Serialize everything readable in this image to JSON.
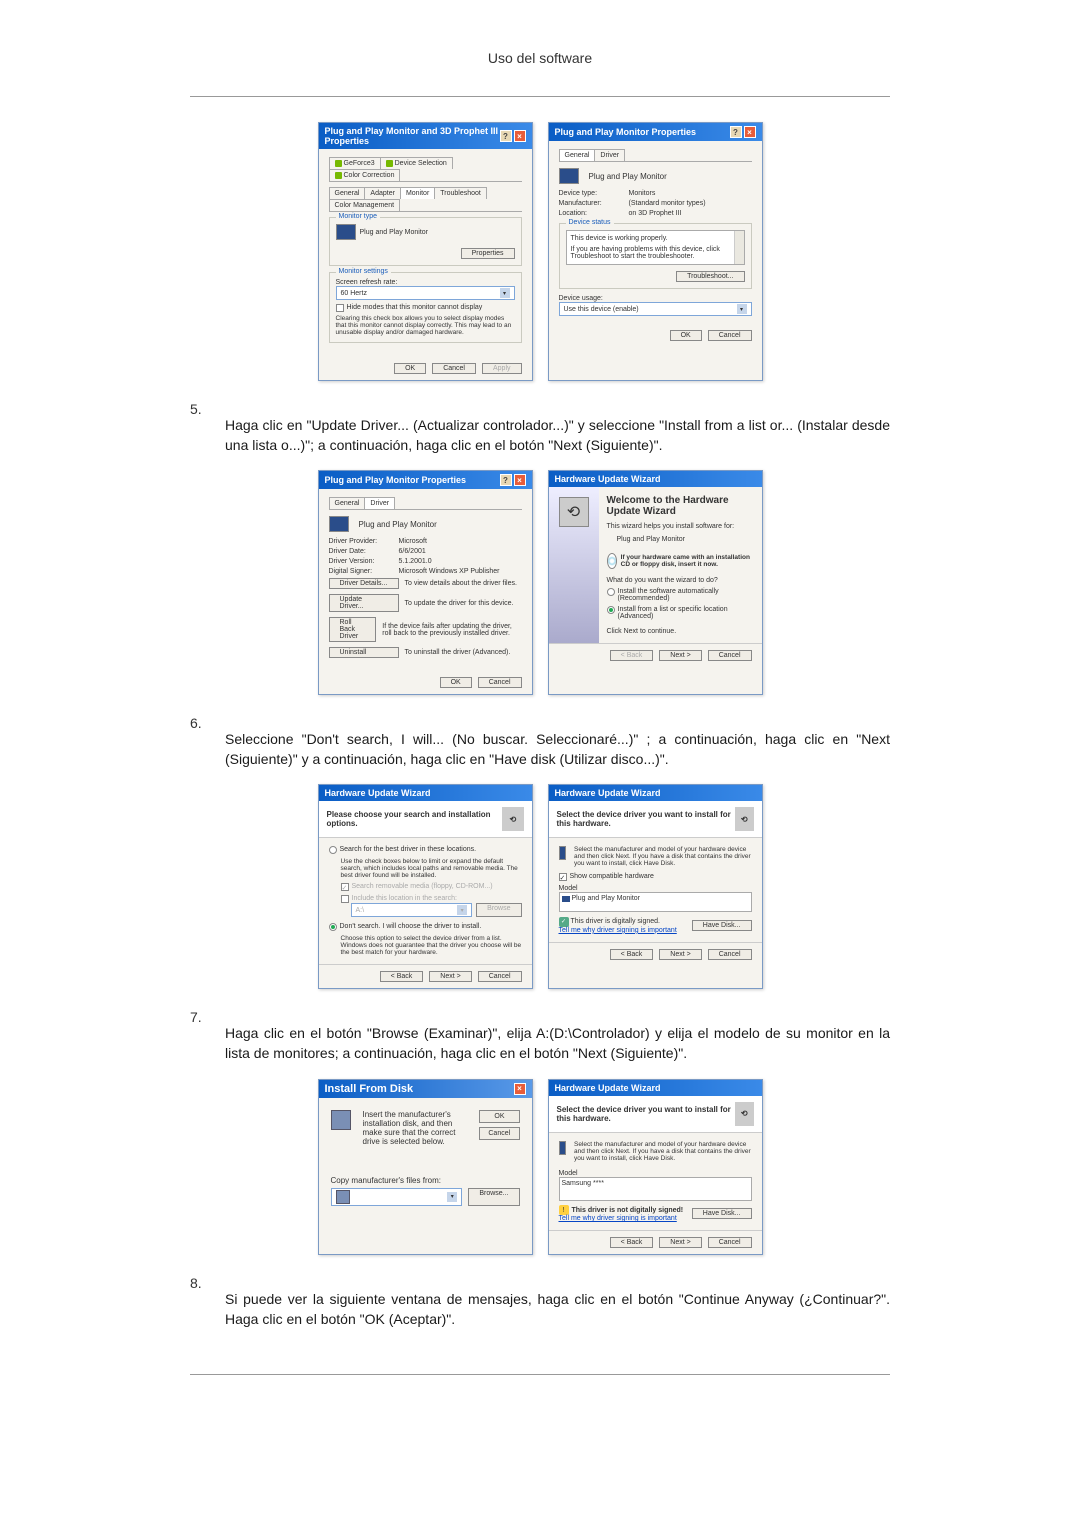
{
  "page_header": "Uso del software",
  "dialog1": {
    "title": "Plug and Play Monitor and 3D Prophet III Properties",
    "tabs_row1": [
      "GeForce3",
      "Device Selection",
      "Color Correction"
    ],
    "tabs_row2": [
      "General",
      "Adapter",
      "Monitor",
      "Troubleshoot",
      "Color Management"
    ],
    "monitor_type_title": "Monitor type",
    "monitor_name": "Plug and Play Monitor",
    "properties_btn": "Properties",
    "monitor_settings_title": "Monitor settings",
    "refresh_label": "Screen refresh rate:",
    "refresh_value": "60 Hertz",
    "hide_modes_label": "Hide modes that this monitor cannot display",
    "hide_modes_desc": "Clearing this check box allows you to select display modes that this monitor cannot display correctly. This may lead to an unusable display and/or damaged hardware.",
    "ok_btn": "OK",
    "cancel_btn": "Cancel",
    "apply_btn": "Apply"
  },
  "dialog2": {
    "title": "Plug and Play Monitor Properties",
    "tab_general": "General",
    "tab_driver": "Driver",
    "device_name": "Plug and Play Monitor",
    "device_type_label": "Device type:",
    "device_type_value": "Monitors",
    "manufacturer_label": "Manufacturer:",
    "manufacturer_value": "(Standard monitor types)",
    "location_label": "Location:",
    "location_value": "on 3D Prophet III",
    "device_status_title": "Device status",
    "status_text1": "This device is working properly.",
    "status_text2": "If you are having problems with this device, click Troubleshoot to start the troubleshooter.",
    "troubleshoot_btn": "Troubleshoot...",
    "usage_label": "Device usage:",
    "usage_value": "Use this device (enable)",
    "ok_btn": "OK",
    "cancel_btn": "Cancel"
  },
  "step5": {
    "num": "5.",
    "text": "Haga clic en \"Update Driver... (Actualizar controlador...)\" y seleccione \"Install from a list or... (Instalar desde una lista o...)\"; a continuación, haga clic en el botón \"Next (Siguiente)\"."
  },
  "dialog3": {
    "title": "Plug and Play Monitor Properties",
    "tab_general": "General",
    "tab_driver": "Driver",
    "device_name": "Plug and Play Monitor",
    "provider_label": "Driver Provider:",
    "provider_value": "Microsoft",
    "date_label": "Driver Date:",
    "date_value": "6/6/2001",
    "version_label": "Driver Version:",
    "version_value": "5.1.2001.0",
    "signer_label": "Digital Signer:",
    "signer_value": "Microsoft Windows XP Publisher",
    "details_btn": "Driver Details...",
    "details_desc": "To view details about the driver files.",
    "update_btn": "Update Driver...",
    "update_desc": "To update the driver for this device.",
    "rollback_btn": "Roll Back Driver",
    "rollback_desc": "If the device fails after updating the driver, roll back to the previously installed driver.",
    "uninstall_btn": "Uninstall",
    "uninstall_desc": "To uninstall the driver (Advanced).",
    "ok_btn": "OK",
    "cancel_btn": "Cancel"
  },
  "dialog4": {
    "title": "Hardware Update Wizard",
    "welcome": "Welcome to the Hardware Update Wizard",
    "helps_text": "This wizard helps you install software for:",
    "device": "Plug and Play Monitor",
    "cd_hint": "If your hardware came with an installation CD or floppy disk, insert it now.",
    "question": "What do you want the wizard to do?",
    "option1": "Install the software automatically (Recommended)",
    "option2": "Install from a list or specific location (Advanced)",
    "continue_text": "Click Next to continue.",
    "back_btn": "< Back",
    "next_btn": "Next >",
    "cancel_btn": "Cancel"
  },
  "step6": {
    "num": "6.",
    "text": "Seleccione \"Don't search, I will... (No buscar. Seleccionaré...)\" ; a continuación, haga clic en \"Next (Siguiente)\" y a continuación, haga clic en \"Have disk (Utilizar disco...)\"."
  },
  "dialog5": {
    "title": "Hardware Update Wizard",
    "header": "Please choose your search and installation options.",
    "opt1": "Search for the best driver in these locations.",
    "opt1_desc": "Use the check boxes below to limit or expand the default search, which includes local paths and removable media. The best driver found will be installed.",
    "chk1": "Search removable media (floppy, CD-ROM...)",
    "chk2": "Include this location in the search:",
    "path_value": "A:\\",
    "browse_btn": "Browse",
    "opt2": "Don't search. I will choose the driver to install.",
    "opt2_desc": "Choose this option to select the device driver from a list. Windows does not guarantee that the driver you choose will be the best match for your hardware.",
    "back_btn": "< Back",
    "next_btn": "Next >",
    "cancel_btn": "Cancel"
  },
  "dialog6": {
    "title": "Hardware Update Wizard",
    "header": "Select the device driver you want to install for this hardware.",
    "instruction": "Select the manufacturer and model of your hardware device and then click Next. If you have a disk that contains the driver you want to install, click Have Disk.",
    "show_compat": "Show compatible hardware",
    "model_label": "Model",
    "model_item": "Plug and Play Monitor",
    "signed_text": "This driver is digitally signed.",
    "signing_link": "Tell me why driver signing is important",
    "have_disk_btn": "Have Disk...",
    "back_btn": "< Back",
    "next_btn": "Next >",
    "cancel_btn": "Cancel"
  },
  "step7": {
    "num": "7.",
    "text": "Haga clic en el botón \"Browse (Examinar)\", elija A:(D:\\Controlador) y elija el modelo de su monitor en la lista de monitores; a continuación, haga clic en el botón \"Next (Siguiente)\"."
  },
  "dialog7": {
    "title": "Install From Disk",
    "instruction": "Insert the manufacturer's installation disk, and then make sure that the correct drive is selected below.",
    "ok_btn": "OK",
    "cancel_btn": "Cancel",
    "copy_label": "Copy manufacturer's files from:",
    "browse_btn": "Browse..."
  },
  "dialog8": {
    "title": "Hardware Update Wizard",
    "header": "Select the device driver you want to install for this hardware.",
    "instruction": "Select the manufacturer and model of your hardware device and then click Next. If you have a disk that contains the driver you want to install, click Have Disk.",
    "model_label": "Model",
    "model_item": "Samsung ****",
    "unsigned_text": "This driver is not digitally signed!",
    "signing_link": "Tell me why driver signing is important",
    "have_disk_btn": "Have Disk...",
    "back_btn": "< Back",
    "next_btn": "Next >",
    "cancel_btn": "Cancel"
  },
  "step8": {
    "num": "8.",
    "text": "Si puede ver la siguiente ventana de mensajes, haga clic en el botón \"Continue Anyway (¿Continuar?\". Haga clic en el botón \"OK (Aceptar)\"."
  }
}
